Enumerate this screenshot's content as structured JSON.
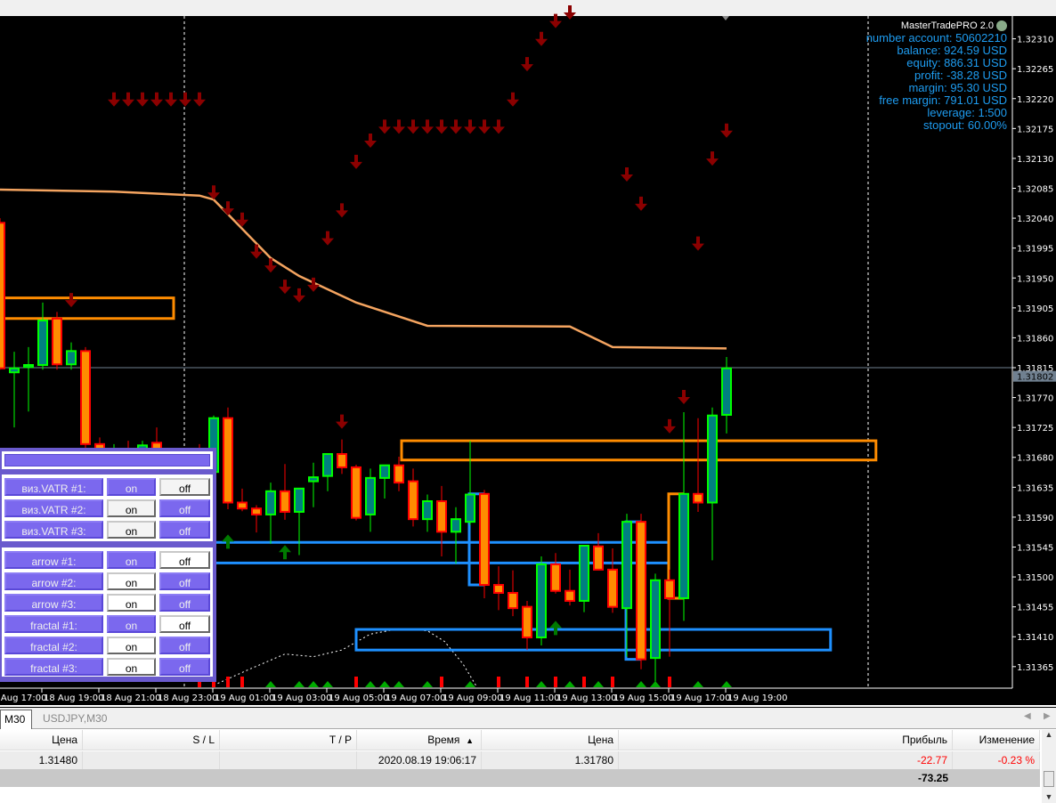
{
  "colors": {
    "bull_fill": "#008080",
    "bull_border": "#00ff00",
    "bear_fill": "#ff8c00",
    "bear_border": "#ff0000",
    "down_arrow": "#8b0000",
    "up_arrow": "#007a00",
    "vatr_line": "#f4a460",
    "zone_orange": "#ff8c00",
    "zone_blue": "#1e90ff",
    "info_text": "#1e9cf0"
  },
  "info_panel": {
    "title": "MasterTradePRO 2.0",
    "lines": [
      "number account: 50602210",
      "balance: 924.59 USD",
      "equity: 886.31 USD",
      "profit: -38.28 USD",
      "margin: 95.30 USD",
      "free margin: 791.01 USD",
      "leverage: 1:500",
      "stopout: 60.00%"
    ]
  },
  "chart_data": {
    "type": "candlestick",
    "symbol_timeframe": "M30",
    "current_price": "1.31802",
    "price_ticks": [
      "1.32310",
      "1.32265",
      "1.32220",
      "1.32175",
      "1.32130",
      "1.32085",
      "1.32040",
      "1.31995",
      "1.31950",
      "1.31905",
      "1.31860",
      "1.31815",
      "1.31770",
      "1.31725",
      "1.31680",
      "1.31635",
      "1.31590",
      "1.31545",
      "1.31500",
      "1.31455",
      "1.31410",
      "1.31365"
    ],
    "time_labels": [
      "18 Aug 17:00",
      "18 Aug 19:00",
      "18 Aug 21:00",
      "18 Aug 23:00",
      "19 Aug 01:00",
      "19 Aug 03:00",
      "19 Aug 05:00",
      "19 Aug 07:00",
      "19 Aug 09:00",
      "19 Aug 11:00",
      "19 Aug 13:00",
      "19 Aug 15:00",
      "19 Aug 17:00",
      "19 Aug 19:00"
    ],
    "candles_ohlc": [
      [
        1.32033,
        1.3204,
        1.31812,
        1.31814
      ],
      [
        1.31808,
        1.31839,
        1.31725,
        1.31814
      ],
      [
        1.31816,
        1.31846,
        1.31749,
        1.31819
      ],
      [
        1.31819,
        1.31913,
        1.31812,
        1.31886
      ],
      [
        1.31889,
        1.31899,
        1.31812,
        1.3182
      ],
      [
        1.3182,
        1.31853,
        1.31812,
        1.3184
      ],
      [
        1.3184,
        1.31846,
        1.3168,
        1.317
      ],
      [
        1.317,
        1.3171,
        1.3164,
        1.3166
      ],
      [
        1.3166,
        1.317,
        1.3165,
        1.3169
      ],
      [
        1.3169,
        1.31705,
        1.31655,
        1.3167
      ],
      [
        1.3168,
        1.31705,
        1.3166,
        1.31698
      ],
      [
        1.31702,
        1.31725,
        1.3165,
        1.3167
      ],
      [
        1.3167,
        1.3169,
        1.3162,
        1.3164
      ],
      [
        1.3164,
        1.3169,
        1.3163,
        1.3167
      ],
      [
        1.3167,
        1.317,
        1.3162,
        1.3165
      ],
      [
        1.31658,
        1.31743,
        1.3164,
        1.31739
      ],
      [
        1.31739,
        1.31755,
        1.31602,
        1.31612
      ],
      [
        1.31612,
        1.31633,
        1.31599,
        1.31603
      ],
      [
        1.31603,
        1.31608,
        1.31567,
        1.31594
      ],
      [
        1.31594,
        1.31642,
        1.3155,
        1.31629
      ],
      [
        1.31629,
        1.3167,
        1.31586,
        1.31598
      ],
      [
        1.31598,
        1.31633,
        1.31533,
        1.31633
      ],
      [
        1.31644,
        1.31672,
        1.31605,
        1.3165
      ],
      [
        1.31652,
        1.31686,
        1.31629,
        1.31685
      ],
      [
        1.31685,
        1.31707,
        1.31655,
        1.31665
      ],
      [
        1.31665,
        1.31669,
        1.31585,
        1.31589
      ],
      [
        1.31594,
        1.31663,
        1.31568,
        1.31649
      ],
      [
        1.31649,
        1.31669,
        1.31618,
        1.31668
      ],
      [
        1.31668,
        1.31681,
        1.31629,
        1.31642
      ],
      [
        1.31644,
        1.31663,
        1.31576,
        1.31587
      ],
      [
        1.31587,
        1.31624,
        1.31568,
        1.31614
      ],
      [
        1.31614,
        1.31637,
        1.31531,
        1.31568
      ],
      [
        1.31568,
        1.31605,
        1.3152,
        1.31587
      ],
      [
        1.31583,
        1.31705,
        1.31578,
        1.31624
      ],
      [
        1.31625,
        1.31631,
        1.31468,
        1.31488
      ],
      [
        1.31488,
        1.31516,
        1.3145,
        1.31476
      ],
      [
        1.31476,
        1.3151,
        1.31441,
        1.31453
      ],
      [
        1.31455,
        1.31464,
        1.3139,
        1.31409
      ],
      [
        1.31409,
        1.31531,
        1.31397,
        1.31519
      ],
      [
        1.31519,
        1.31536,
        1.31475,
        1.31479
      ],
      [
        1.31479,
        1.31511,
        1.31457,
        1.31464
      ],
      [
        1.31464,
        1.31547,
        1.31447,
        1.31547
      ],
      [
        1.31546,
        1.31566,
        1.31511,
        1.31511
      ],
      [
        1.31511,
        1.31543,
        1.31446,
        1.31455
      ],
      [
        1.31453,
        1.31595,
        1.3138,
        1.31583
      ],
      [
        1.31583,
        1.31595,
        1.31361,
        1.31376
      ],
      [
        1.31378,
        1.31505,
        1.31342,
        1.31495
      ],
      [
        1.31495,
        1.31511,
        1.3138,
        1.31468
      ],
      [
        1.31468,
        1.31748,
        1.31434,
        1.31625
      ],
      [
        1.31625,
        1.31739,
        1.31598,
        1.31612
      ],
      [
        1.31612,
        1.31755,
        1.31525,
        1.31743
      ],
      [
        1.31744,
        1.31831,
        1.31716,
        1.31814
      ]
    ],
    "down_arrows": [
      [
        5,
        1.31906
      ],
      [
        8,
        1.32208
      ],
      [
        9,
        1.32208
      ],
      [
        10,
        1.32208
      ],
      [
        11,
        1.32208
      ],
      [
        12,
        1.32208
      ],
      [
        13,
        1.32208
      ],
      [
        14,
        1.32208
      ],
      [
        15,
        1.32068
      ],
      [
        16,
        1.32044
      ],
      [
        17,
        1.32027
      ],
      [
        18,
        1.31979
      ],
      [
        19,
        1.31958
      ],
      [
        20,
        1.31926
      ],
      [
        21,
        1.31913
      ],
      [
        22,
        1.31929
      ],
      [
        23,
        1.31999
      ],
      [
        24,
        1.32041
      ],
      [
        24,
        1.31723
      ],
      [
        25,
        1.32114
      ],
      [
        26,
        1.32146
      ],
      [
        27,
        1.32167
      ],
      [
        28,
        1.32167
      ],
      [
        29,
        1.32167
      ],
      [
        30,
        1.32167
      ],
      [
        31,
        1.32167
      ],
      [
        32,
        1.32167
      ],
      [
        33,
        1.32167
      ],
      [
        34,
        1.32167
      ],
      [
        35,
        1.32167
      ],
      [
        36,
        1.32208
      ],
      [
        37,
        1.32261
      ],
      [
        38,
        1.32299
      ],
      [
        39,
        1.32326
      ],
      [
        40,
        1.32339
      ],
      [
        44,
        1.32095
      ],
      [
        45,
        1.32051
      ],
      [
        47,
        1.31716
      ],
      [
        48,
        1.3176
      ],
      [
        49,
        1.31991
      ],
      [
        50,
        1.32119
      ],
      [
        51,
        1.32161
      ]
    ],
    "up_arrows": [
      [
        16,
        1.31564
      ],
      [
        20,
        1.31548
      ],
      [
        39,
        1.31434
      ]
    ],
    "vatr_line": [
      [
        0,
        1.32083
      ],
      [
        8,
        1.3208
      ],
      [
        14,
        1.32074
      ],
      [
        15,
        1.32068
      ],
      [
        19,
        1.3198
      ],
      [
        21,
        1.31953
      ],
      [
        25,
        1.31913
      ],
      [
        30,
        1.31878
      ],
      [
        40,
        1.31877
      ],
      [
        43,
        1.31846
      ],
      [
        51,
        1.31844
      ]
    ],
    "dotted_curve": [
      [
        15,
        1.31337
      ],
      [
        17.5,
        1.31361
      ],
      [
        20,
        1.31384
      ],
      [
        22,
        1.3138
      ],
      [
        24,
        1.3139
      ],
      [
        26,
        1.31414
      ],
      [
        28,
        1.31422
      ],
      [
        30,
        1.31419
      ],
      [
        31.2,
        1.31403
      ],
      [
        32.5,
        1.31369
      ],
      [
        33.4,
        1.31337
      ]
    ],
    "orange_zones": [
      {
        "from": 0,
        "to": 12,
        "top": 1.3192,
        "bottom": 1.31889
      },
      {
        "from": 28,
        "to": 61.3,
        "top": 1.31705,
        "bottom": 1.31676
      }
    ],
    "blue_lines": [
      {
        "from": 15,
        "to": 47,
        "price": 1.31552
      },
      {
        "from": 15,
        "to": 47,
        "price": 1.31521
      }
    ],
    "blue_zone": {
      "from": 25,
      "to": 58.3,
      "top": 1.31421,
      "bottom": 1.3139
    },
    "blue_brackets": [
      {
        "at": 33,
        "to": 34,
        "top": 1.31625,
        "bottom": 1.31488
      },
      {
        "at": 44,
        "to": 45,
        "top": 1.31583,
        "bottom": 1.31376
      }
    ],
    "orange_bracket": {
      "at": 47,
      "to": 48,
      "top": 1.31625,
      "bottom": 1.31468
    },
    "bottom_markers": [
      [
        14,
        "sell"
      ],
      [
        15,
        "sell"
      ],
      [
        16,
        "sell"
      ],
      [
        17,
        "sell"
      ],
      [
        19,
        "buy"
      ],
      [
        21,
        "buy"
      ],
      [
        22,
        "buy"
      ],
      [
        23,
        "buy"
      ],
      [
        25,
        "sell"
      ],
      [
        26,
        "buy"
      ],
      [
        27,
        "buy"
      ],
      [
        28,
        "buy"
      ],
      [
        30,
        "buy"
      ],
      [
        31,
        "sell"
      ],
      [
        33,
        "buy"
      ],
      [
        35,
        "sell"
      ],
      [
        37,
        "sell"
      ],
      [
        38,
        "buy"
      ],
      [
        39,
        "sell"
      ],
      [
        40,
        "buy"
      ],
      [
        41,
        "sell"
      ],
      [
        42,
        "buy"
      ],
      [
        43,
        "sell"
      ],
      [
        45,
        "buy"
      ],
      [
        46,
        "buy"
      ],
      [
        47,
        "sell"
      ],
      [
        49,
        "buy"
      ],
      [
        51,
        "buy"
      ]
    ]
  },
  "control_panel": {
    "vatr": [
      {
        "label": "виз.VATR #1:",
        "on": "on",
        "off": "off"
      },
      {
        "label": "виз.VATR #2:",
        "on": "on",
        "off": "off"
      },
      {
        "label": "виз.VATR #3:",
        "on": "on",
        "off": "off"
      }
    ],
    "signals": [
      {
        "label": "arrow #1:",
        "on": "on",
        "off": "off"
      },
      {
        "label": "arrow #2:",
        "on": "on",
        "off": "off"
      },
      {
        "label": "arrow #3:",
        "on": "on",
        "off": "off"
      },
      {
        "label": "fractal #1:",
        "on": "on",
        "off": "off"
      },
      {
        "label": "fractal #2:",
        "on": "on",
        "off": "off"
      },
      {
        "label": "fractal #3:",
        "on": "on",
        "off": "off"
      }
    ]
  },
  "bottom_panel": {
    "tabs": [
      "M30",
      "USDJPY,M30"
    ],
    "headers": {
      "price_open": "Цена",
      "sl": "S / L",
      "tp": "T / P",
      "time": "Время",
      "sort_icon": "▲",
      "price_current": "Цена",
      "profit": "Прибыль",
      "change": "Изменение"
    },
    "row": {
      "price_open": "1.31480",
      "sl": "",
      "tp": "",
      "time": "2020.08.19 19:06:17",
      "price_current": "1.31780",
      "profit": "-22.77",
      "change": "-0.23 %"
    },
    "total": "-73.25"
  }
}
